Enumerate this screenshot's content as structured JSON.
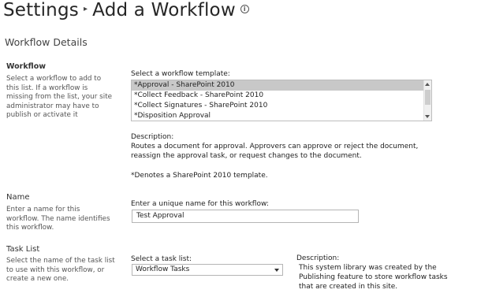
{
  "header": {
    "breadcrumb_root": "Settings",
    "separator": "▸",
    "page_title": "Add a Workflow",
    "info_icon": "i"
  },
  "section_title": "Workflow Details",
  "workflow": {
    "heading": "Workflow",
    "description_lines": [
      "Select a workflow to add to",
      "this list. If a workflow is",
      "missing from the list, your site",
      "administrator may have to",
      "publish or activate it"
    ],
    "template_label": "Select a workflow template:",
    "templates": [
      "*Approval - SharePoint 2010",
      "*Collect Feedback - SharePoint 2010",
      "*Collect Signatures - SharePoint 2010",
      "*Disposition Approval"
    ],
    "selected_index": 0,
    "description_label": "Description:",
    "description_text_lines": [
      "Routes a document for approval. Approvers can approve or reject the document,",
      "reassign the approval task, or request changes to the document."
    ],
    "footnote": "*Denotes a SharePoint 2010 template."
  },
  "name": {
    "heading": "Name",
    "description_lines": [
      "Enter a name for this",
      "workflow. The name identifies",
      "this workflow."
    ],
    "input_label": "Enter a unique name for this workflow:",
    "input_value": "Test Approval"
  },
  "task_list": {
    "heading": "Task List",
    "description_lines": [
      "Select the name of the task list",
      "to use with this workflow, or",
      "create a new one."
    ],
    "select_label": "Select a task list:",
    "select_value": "Workflow Tasks",
    "description_label": "Description:",
    "description_text_lines": [
      "This system library was created by the",
      "Publishing feature to store workflow tasks",
      "that are created in this site."
    ]
  }
}
